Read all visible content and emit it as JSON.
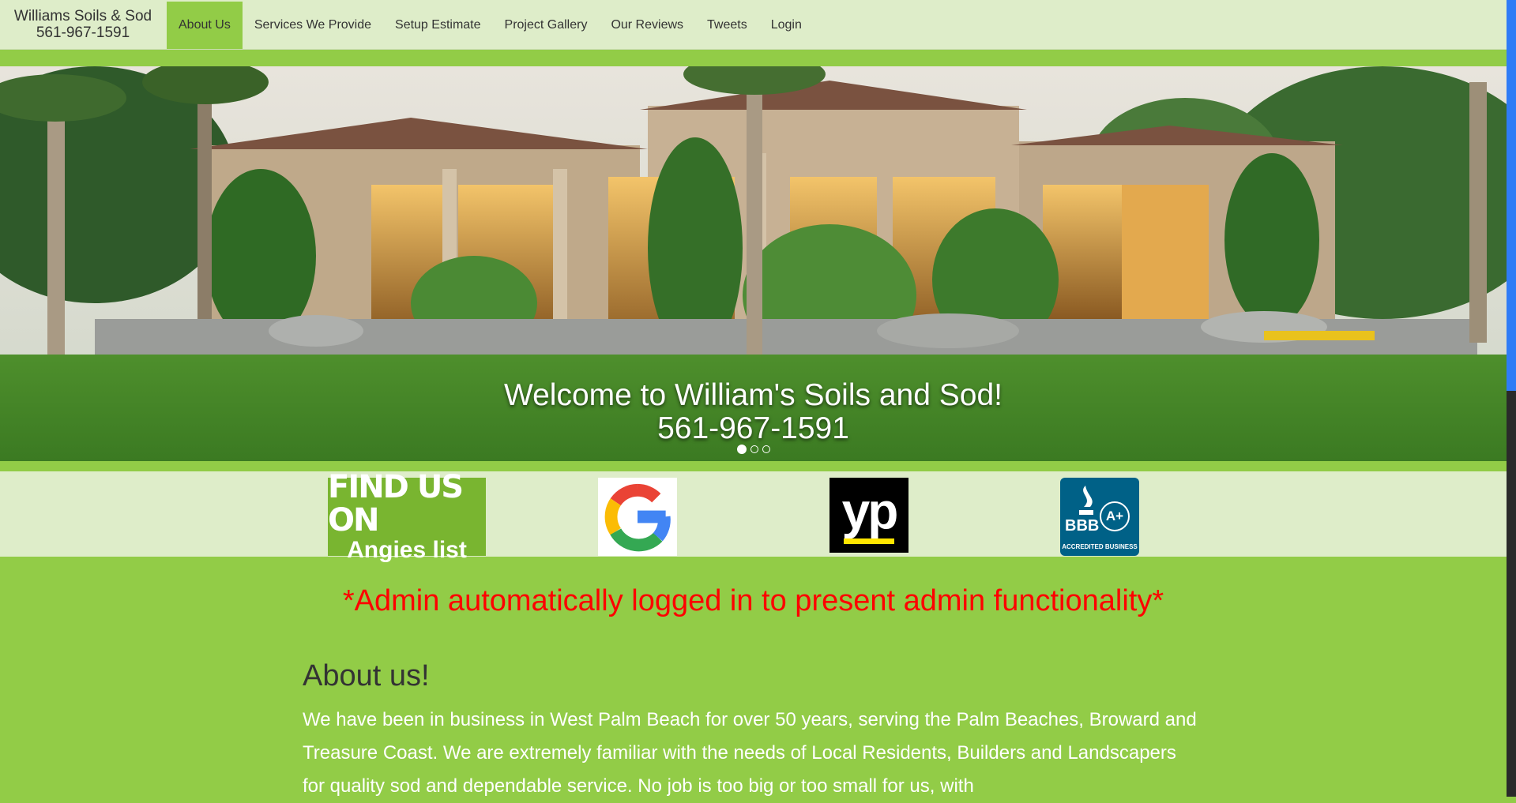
{
  "brand": {
    "name": "Williams Soils & Sod",
    "phone": "561-967-1591"
  },
  "nav": {
    "items": [
      {
        "label": "About Us",
        "active": true
      },
      {
        "label": "Services We Provide"
      },
      {
        "label": "Setup Estimate"
      },
      {
        "label": "Project Gallery"
      },
      {
        "label": "Our Reviews"
      },
      {
        "label": "Tweets"
      },
      {
        "label": "Login"
      }
    ]
  },
  "hero": {
    "caption_line1": "Welcome to William's Soils and Sod!",
    "caption_line2": "561-967-1591",
    "slide_count": 3,
    "active_slide": 1
  },
  "badges": {
    "angies_line1": "FIND US ON",
    "angies_line2": "Angies list",
    "yp": "yp",
    "bbb": "BBB",
    "bbb_rating": "A+",
    "bbb_caption": "ACCREDITED BUSINESS"
  },
  "admin_note": "*Admin automatically logged in to present admin functionality*",
  "about": {
    "heading": "About us!",
    "body": "We have been in business in West Palm Beach for over 50 years, serving the Palm Beaches, Broward and Treasure Coast. We are extremely familiar with the needs of Local Residents, Builders and Landscapers for quality sod and dependable service. No job is too big or too small for us, with"
  },
  "colors": {
    "page_green": "#92cc47",
    "nav_bg": "#deedc9",
    "alert_red": "#ff0000",
    "scroll_blue": "#2f7cf6"
  }
}
